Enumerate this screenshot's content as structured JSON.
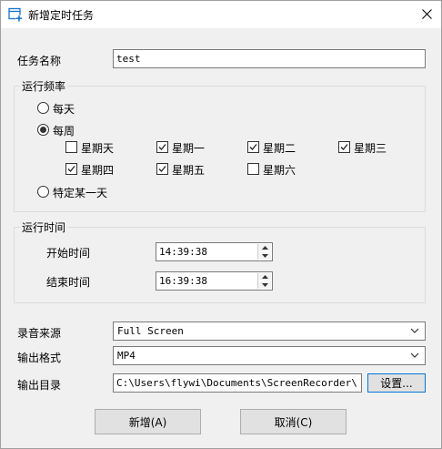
{
  "window": {
    "title": "新增定时任务"
  },
  "task_name": {
    "label": "任务名称",
    "value": "test"
  },
  "frequency": {
    "group_title": "运行频率",
    "daily_label": "每天",
    "weekly_label": "每周",
    "specific_day_label": "特定某一天",
    "selected": "weekly",
    "days": [
      {
        "label": "星期天",
        "checked": false
      },
      {
        "label": "星期一",
        "checked": true
      },
      {
        "label": "星期二",
        "checked": true
      },
      {
        "label": "星期三",
        "checked": true
      },
      {
        "label": "星期四",
        "checked": true
      },
      {
        "label": "星期五",
        "checked": true
      },
      {
        "label": "星期六",
        "checked": false
      }
    ]
  },
  "run_time": {
    "group_title": "运行时间",
    "start_label": "开始时间",
    "start_value": "14:39:38",
    "end_label": "结束时间",
    "end_value": "16:39:38"
  },
  "audio_source": {
    "label": "录音来源",
    "value": "Full Screen"
  },
  "output_format": {
    "label": "输出格式",
    "value": "MP4"
  },
  "output_dir": {
    "label": "输出目录",
    "value": "C:\\Users\\flywi\\Documents\\ScreenRecorder\\",
    "settings_button": "设置..."
  },
  "buttons": {
    "add": "新增(A)",
    "cancel": "取消(C)"
  }
}
